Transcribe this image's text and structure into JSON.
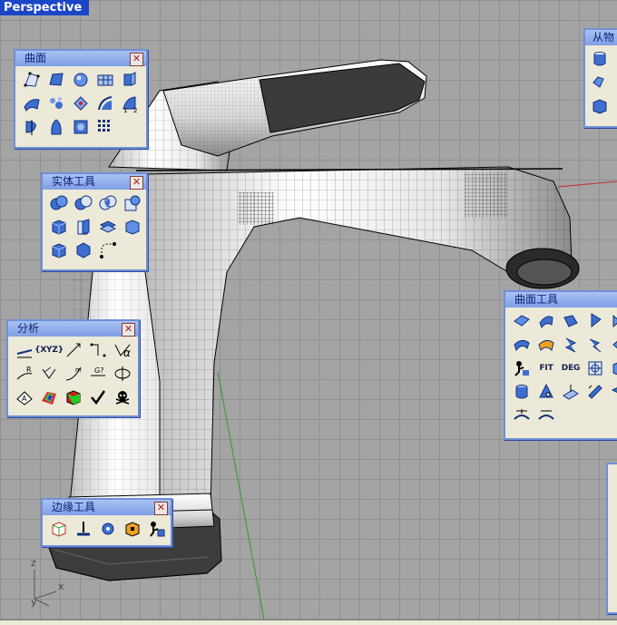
{
  "viewport": {
    "title": "Perspective"
  },
  "axes": {
    "z": "z",
    "x": "x",
    "y": "y"
  },
  "toolbars": {
    "surface": {
      "title": "曲面",
      "close": "✕"
    },
    "solid_tools": {
      "title": "实体工具",
      "close": "✕"
    },
    "analysis": {
      "title": "分析",
      "close": "✕",
      "xyz": "{XYZ}"
    },
    "edge_tools": {
      "title": "边缘工具",
      "close": "✕"
    },
    "surface_tools": {
      "title": "曲面工具",
      "fit": "FIT",
      "deg": "DEG"
    },
    "from_object": {
      "title": "从物"
    }
  },
  "colors": {
    "title_bar": "#1b46c8",
    "toolbar_bg": "#ece9d8",
    "toolbar_border": "#6f8fd8",
    "grid_bg": "#a4a4a4"
  }
}
